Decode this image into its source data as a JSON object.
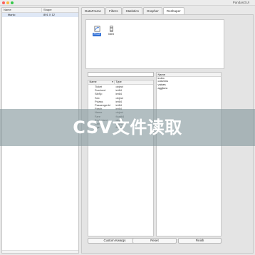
{
  "window": {
    "title": "PandasGUI"
  },
  "left_panel": {
    "headers": [
      "Name",
      "Shape"
    ],
    "rows": [
      {
        "name": "titanic",
        "shape": "891 X 12"
      }
    ]
  },
  "tabs": [
    {
      "label": "DataFrame",
      "active": false
    },
    {
      "label": "Filters",
      "active": false
    },
    {
      "label": "Statistics",
      "active": false
    },
    {
      "label": "Grapher",
      "active": false
    },
    {
      "label": "Reshaper",
      "active": true
    }
  ],
  "reshaper": {
    "operations": [
      {
        "label": "Pivot",
        "icon": "pivot-icon",
        "selected": true
      },
      {
        "label": "Melt",
        "icon": "melt-icon",
        "selected": false
      }
    ],
    "search": {
      "value": ""
    },
    "columns_headers": [
      "Name",
      "Type"
    ],
    "columns": [
      {
        "name": "Ticket",
        "type": "object"
      },
      {
        "name": "Survived",
        "type": "int64"
      },
      {
        "name": "SibSp",
        "type": "int64"
      },
      {
        "name": "Sex",
        "type": "object"
      },
      {
        "name": "Pclass",
        "type": "int64"
      },
      {
        "name": "PassengerId",
        "type": "int64"
      },
      {
        "name": "Parch",
        "type": "int64"
      },
      {
        "name": "Name",
        "type": "object"
      },
      {
        "name": "Fare",
        "type": "float64"
      },
      {
        "name": "Embarked",
        "type": "object"
      },
      {
        "name": "Cabin",
        "type": "object"
      },
      {
        "name": "Age",
        "type": "float64"
      }
    ],
    "params_header": "Name",
    "params": [
      "index",
      "columns",
      "values",
      "aggfunc"
    ],
    "buttons": {
      "custom_kwargs": "Custom Kwargs",
      "reset": "Reset",
      "finish": "Finish"
    }
  },
  "banner": {
    "text": "CSV文件读取"
  },
  "colors": {
    "selected_accent": "#2f6fd6",
    "banner_overlay": "#82969b"
  }
}
